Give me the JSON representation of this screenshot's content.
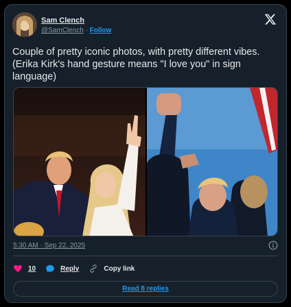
{
  "author": {
    "name": "Sam Clench",
    "handle": "@SamClench",
    "separator": " · ",
    "follow_label": "Follow"
  },
  "tweet": {
    "text_line1": "Couple of pretty iconic photos, with pretty different vibes.",
    "text_line2": "(Erika Kirk's hand gesture means \"I love you\" in sign",
    "text_line3": "language)",
    "timestamp": "5:30 AM · Sep 22, 2025"
  },
  "actions": {
    "like_count": "10",
    "reply_label": "Reply",
    "copy_label": "Copy link"
  },
  "footer": {
    "read_replies_label": "Read 8 replies"
  },
  "icons": {
    "logo": "x-logo-icon",
    "info": "info-icon",
    "like": "heart-icon",
    "reply": "reply-bubble-icon",
    "copy": "link-icon"
  },
  "colors": {
    "background": "#15202b",
    "accent": "#1d9bf0",
    "like": "#f91880",
    "text": "#e7e9ea",
    "muted": "#8b98a5"
  }
}
